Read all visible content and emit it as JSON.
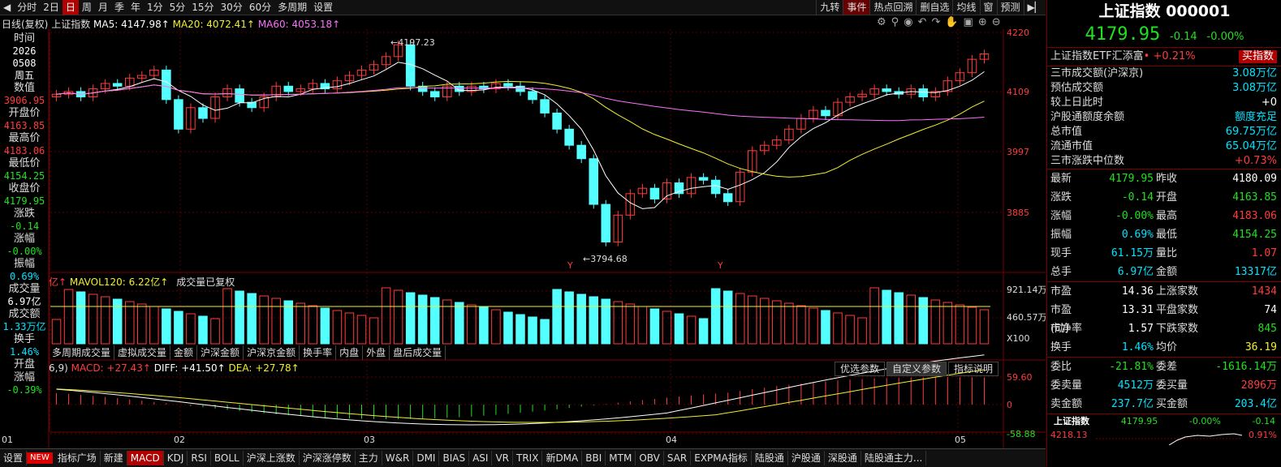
{
  "toolbar": {
    "items": [
      "分时",
      "2日",
      "日",
      "周",
      "月",
      "季",
      "年",
      "1分",
      "5分",
      "15分",
      "30分",
      "60分",
      "多周期",
      "设置"
    ],
    "active": "日",
    "right_items": [
      "九转",
      "事件",
      "热点回溯",
      "删自选",
      "均线",
      "窗",
      "预测"
    ]
  },
  "chart_header": {
    "label": "日线(复权)",
    "name": "上证指数",
    "ma5": "MA5: 4147.98↑",
    "ma20": "MA20: 4072.41↑",
    "ma60": "MA60: 4053.18↑"
  },
  "left_panel": {
    "items": [
      {
        "label": "时间",
        "value": "2026",
        "color": "white"
      },
      {
        "label": "",
        "value": "0508",
        "color": "white"
      },
      {
        "label": "",
        "value": "周五",
        "color": "white"
      },
      {
        "label": "数值",
        "value": "3906.95",
        "color": "red"
      },
      {
        "label": "开盘价",
        "value": "4163.85",
        "color": "red"
      },
      {
        "label": "最高价",
        "value": "4183.06",
        "color": "red"
      },
      {
        "label": "最低价",
        "value": "4154.25",
        "color": "green"
      },
      {
        "label": "收盘价",
        "value": "4179.95",
        "color": "green"
      },
      {
        "label": "涨跌",
        "value": "-0.14",
        "color": "green"
      },
      {
        "label": "涨幅",
        "value": "-0.00%",
        "color": "green"
      },
      {
        "label": "振幅",
        "value": "0.69%",
        "color": "cyan"
      },
      {
        "label": "成交量",
        "value": "6.97亿",
        "color": "white"
      },
      {
        "label": "成交额",
        "value": "1.33万亿",
        "color": "cyan"
      },
      {
        "label": "换手",
        "value": "1.46%",
        "color": "cyan"
      },
      {
        "label": "开盘",
        "value": "",
        "color": "white"
      },
      {
        "label": "涨幅",
        "value": "-0.39%",
        "color": "green"
      }
    ]
  },
  "price_axis": [
    "4220",
    "4109",
    "3997",
    "3885"
  ],
  "annotations": {
    "high": "4197.23",
    "low": "3794.68",
    "marker": "Y"
  },
  "volume": {
    "legend_prefix": "亿↑",
    "mavol": "MAVOL120: 6.22亿↑",
    "note": "成交量已复权",
    "axis": [
      "921.14万",
      "460.57万",
      "X100"
    ],
    "tabs": [
      "多周期成交量",
      "虚拟成交量",
      "金额",
      "沪深金额",
      "沪深京金额",
      "换手率",
      "内盘",
      "外盘",
      "盘后成交量"
    ]
  },
  "macd": {
    "prefix": "6,9)",
    "macd": "MACD: +27.43↑",
    "diff": "DIFF: +41.50↑",
    "dea": "DEA: +27.78↑",
    "axis": [
      "59.60",
      "0",
      "-58.88"
    ],
    "buttons": [
      "优选参数",
      "自定义参数",
      "指标说明"
    ]
  },
  "date_axis": [
    "01",
    "02",
    "03",
    "04",
    "05"
  ],
  "bottom_tabs": [
    "设置",
    "NEW",
    "指标广场",
    "新建",
    "MACD",
    "KDJ",
    "RSI",
    "BOLL",
    "沪深上涨数",
    "沪深涨停数",
    "主力",
    "W&R",
    "DMI",
    "BIAS",
    "ASI",
    "VR",
    "TRIX",
    "新DMA",
    "BBI",
    "MTM",
    "OBV",
    "SAR",
    "EXPMA指标",
    "陆股通",
    "沪股通",
    "深股通",
    "陆股通主力..."
  ],
  "right_panel": {
    "title": "上证指数 000001",
    "price": "4179.95",
    "change": "-0.14",
    "change_pct": "-0.00%",
    "etf": "上证指数ETF汇添富",
    "etf_pct": "+0.21%",
    "buy_btn": "买指数",
    "stats": [
      {
        "label": "三市成交额(沪深京)",
        "value": "3.08万亿",
        "color": "cyan"
      },
      {
        "label": "预估成交额",
        "value": "3.08万亿",
        "color": "cyan"
      },
      {
        "label": "较上日此时",
        "value": "+0",
        "color": "white"
      },
      {
        "label": "沪股通额度余额",
        "value": "额度充足",
        "color": "cyan"
      },
      {
        "label": "总市值",
        "value": "69.75万亿",
        "color": "cyan"
      },
      {
        "label": "流通市值",
        "value": "65.04万亿",
        "color": "cyan"
      },
      {
        "label": "三市涨跌中位数",
        "value": "+0.73%",
        "color": "red"
      }
    ],
    "quote": [
      {
        "l1": "最新",
        "v1": "4179.95",
        "c1": "green",
        "l2": "昨收",
        "v2": "4180.09",
        "c2": "white"
      },
      {
        "l1": "涨跌",
        "v1": "-0.14",
        "c1": "green",
        "l2": "开盘",
        "v2": "4163.85",
        "c2": "green"
      },
      {
        "l1": "涨幅",
        "v1": "-0.00%",
        "c1": "green",
        "l2": "最高",
        "v2": "4183.06",
        "c2": "red"
      },
      {
        "l1": "振幅",
        "v1": "0.69%",
        "c1": "cyan",
        "l2": "最低",
        "v2": "4154.25",
        "c2": "green"
      },
      {
        "l1": "现手",
        "v1": "61.15万",
        "c1": "cyan",
        "l2": "量比",
        "v2": "1.07",
        "c2": "red"
      },
      {
        "l1": "总手",
        "v1": "6.97亿",
        "c1": "cyan",
        "l2": "金额",
        "v2": "13317亿",
        "c2": "cyan"
      }
    ],
    "fundamentals": [
      {
        "l1": "市盈",
        "v1": "14.36",
        "c1": "white",
        "l2": "上涨家数",
        "v2": "1434",
        "c2": "red"
      },
      {
        "l1": "市盈(动)",
        "v1": "13.31",
        "c1": "white",
        "l2": "平盘家数",
        "v2": "74",
        "c2": "white"
      },
      {
        "l1": "市净率",
        "v1": "1.57",
        "c1": "white",
        "l2": "下跌家数",
        "v2": "845",
        "c2": "green"
      },
      {
        "l1": "换手",
        "v1": "1.46%",
        "c1": "cyan",
        "l2": "均价",
        "v2": "36.19",
        "c2": "yellow"
      }
    ],
    "orders": [
      {
        "l1": "委比",
        "v1": "-21.81%",
        "c1": "green",
        "l2": "委差",
        "v2": "-1616.14万",
        "c2": "green"
      },
      {
        "l1": "委卖量",
        "v1": "4512万",
        "c1": "cyan",
        "l2": "委买量",
        "v2": "2896万",
        "c2": "red"
      },
      {
        "l1": "卖金额",
        "v1": "237.7亿",
        "c1": "cyan",
        "l2": "买金额",
        "v2": "203.4亿",
        "c2": "cyan"
      }
    ],
    "mini": {
      "name": "上证指数",
      "price": "4179.95",
      "pct": "-0.00%",
      "chg": "-0.14",
      "left": "4218.13",
      "right": "0.91%"
    }
  }
}
